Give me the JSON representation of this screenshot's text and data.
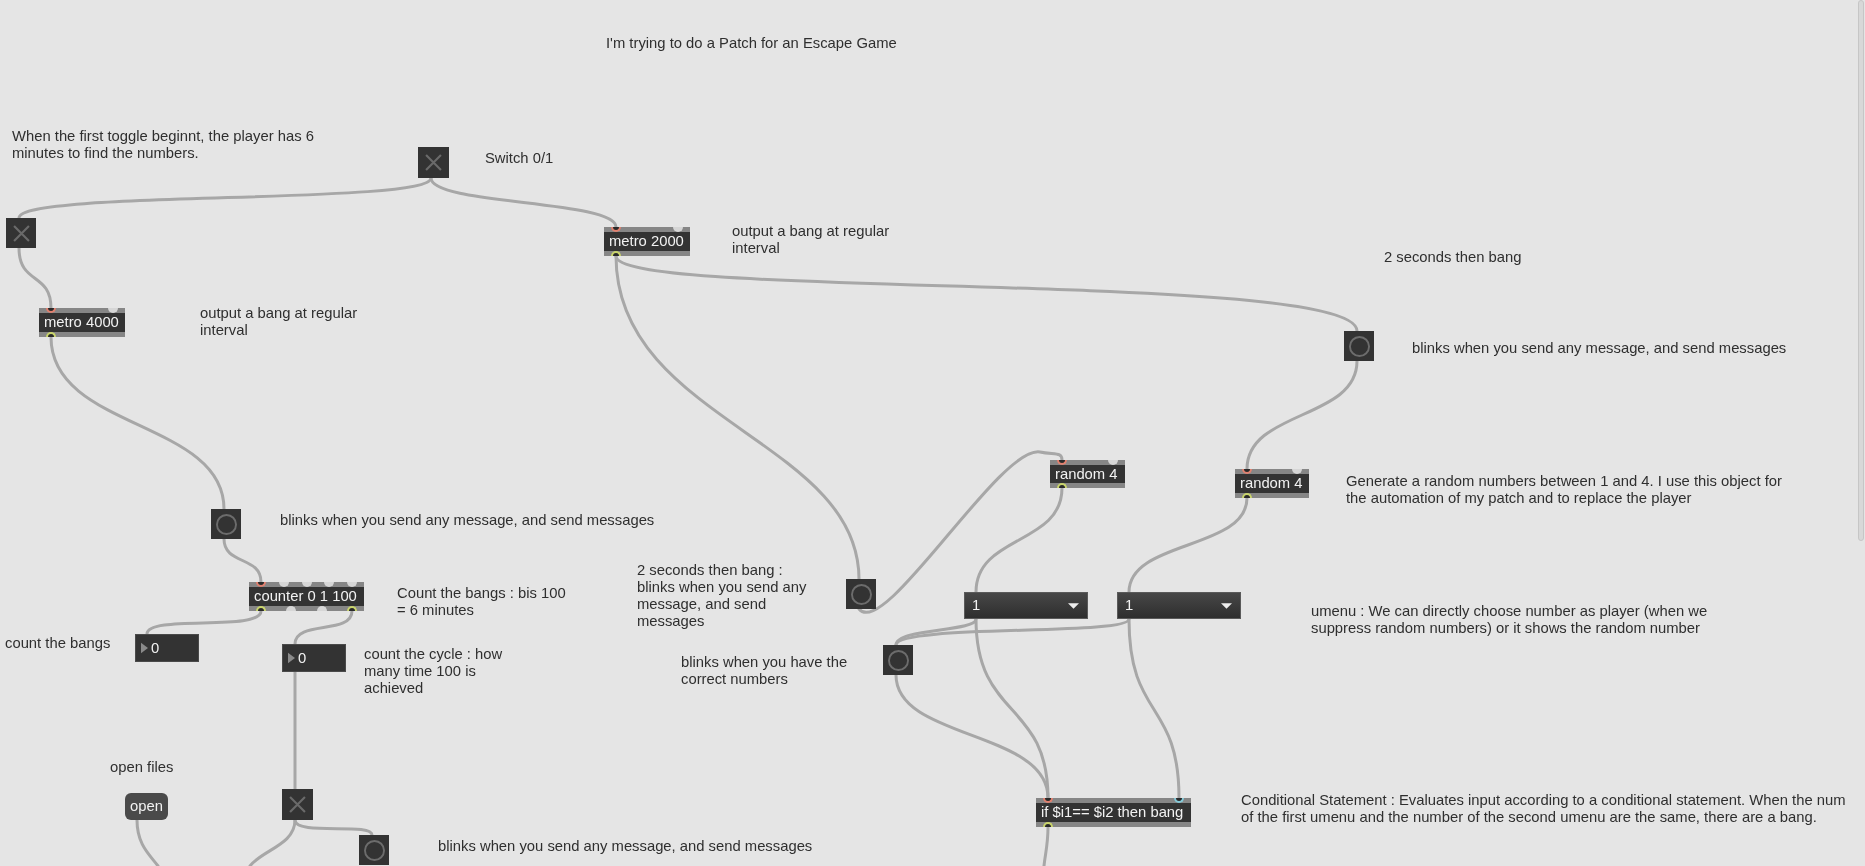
{
  "patcher": {
    "boxes": [
      {
        "kind": "comment",
        "text": "I'm trying to do a Patch for an Escape Game"
      },
      {
        "kind": "comment",
        "text": "When the first toggle beginnt, the player has 6 minutes to find the numbers."
      },
      {
        "kind": "toggle",
        "checked": false
      },
      {
        "kind": "comment",
        "text": "Switch 0/1"
      },
      {
        "kind": "toggle",
        "checked": false
      },
      {
        "kind": "object",
        "text": "metro 2000"
      },
      {
        "kind": "comment",
        "text": "output a bang at regular interval"
      },
      {
        "kind": "comment",
        "text": "2 seconds then bang"
      },
      {
        "kind": "object",
        "text": "metro 4000"
      },
      {
        "kind": "comment",
        "text": "output a bang at regular interval"
      },
      {
        "kind": "bang"
      },
      {
        "kind": "comment",
        "text": "blinks when you send any message, and send messages"
      },
      {
        "kind": "object",
        "text": "random 4"
      },
      {
        "kind": "object",
        "text": "random 4"
      },
      {
        "kind": "comment",
        "text": "Generate a random numbers between 1 and 4. I use this object for the automation of my patch and to replace the player"
      },
      {
        "kind": "bang"
      },
      {
        "kind": "comment",
        "text": "blinks when you send any message, and send messages"
      },
      {
        "kind": "object",
        "text": "counter 0 1 100"
      },
      {
        "kind": "comment",
        "text": "Count the bangs : bis 100 = 6 minutes"
      },
      {
        "kind": "comment",
        "text": "2 seconds then bang : blinks when you send any message, and send messages"
      },
      {
        "kind": "bang"
      },
      {
        "kind": "umenu",
        "value": "1"
      },
      {
        "kind": "umenu",
        "value": "1"
      },
      {
        "kind": "comment",
        "text": "umenu : We can directly choose number as player (when we suppress random numbers) or it shows the random number"
      },
      {
        "kind": "comment",
        "text": "count the bangs"
      },
      {
        "kind": "number",
        "value": "0"
      },
      {
        "kind": "number",
        "value": "0"
      },
      {
        "kind": "comment",
        "text": "count the cycle : how many time 100 is achieved"
      },
      {
        "kind": "comment",
        "text": "blinks when you have the correct numbers"
      },
      {
        "kind": "bang"
      },
      {
        "kind": "comment",
        "text": "open files"
      },
      {
        "kind": "message",
        "text": "open"
      },
      {
        "kind": "toggle",
        "checked": false
      },
      {
        "kind": "object",
        "text": "if $i1== $i2 then bang"
      },
      {
        "kind": "comment",
        "text": "Conditional Statement : Evaluates input according to a conditional statement. When the num of the first umenu and the number of the second umenu are the same, there are a bang."
      },
      {
        "kind": "bang"
      },
      {
        "kind": "comment",
        "text": "blinks when you send any message, and send messages"
      }
    ]
  }
}
